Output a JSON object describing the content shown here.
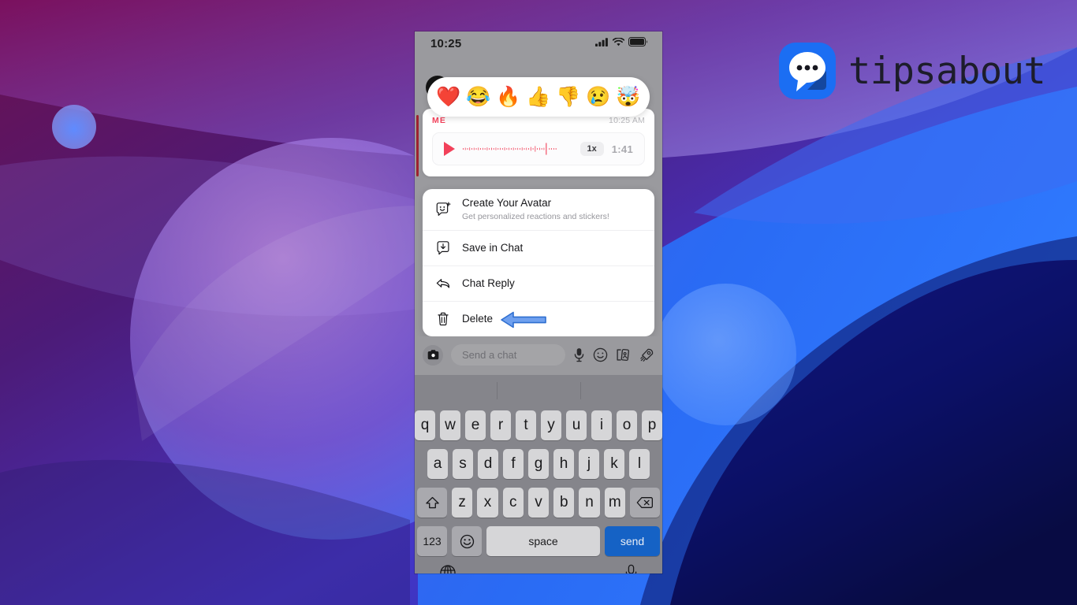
{
  "brand": {
    "name": "tipsabout",
    "logo_icon": "speech-bubble-dots-icon",
    "colors": {
      "mark_blue": "#1b6ef3",
      "mark_shadow": "#1546a0",
      "word": "#1d1d2b"
    }
  },
  "phone": {
    "status_bar": {
      "time": "10:25",
      "cellular_icon": "signal-bars-icon",
      "wifi_icon": "wifi-icon",
      "battery_icon": "battery-full-icon"
    },
    "reaction_bar": {
      "emojis": [
        {
          "name": "heart-emoji",
          "glyph": "❤️"
        },
        {
          "name": "joy-emoji",
          "glyph": "😂"
        },
        {
          "name": "fire-emoji",
          "glyph": "🔥"
        },
        {
          "name": "thumbs-up-emoji",
          "glyph": "👍"
        },
        {
          "name": "thumbs-down-emoji",
          "glyph": "👎"
        },
        {
          "name": "crying-emoji",
          "glyph": "😢"
        },
        {
          "name": "mind-blown-emoji",
          "glyph": "🤯"
        }
      ]
    },
    "message": {
      "sender": "ME",
      "timestamp": "10:25 AM",
      "play_icon": "play-icon",
      "waveform_icon": "audio-waveform",
      "speed": "1x",
      "duration": "1:41",
      "accent_color": "#f2415a"
    },
    "context_menu": {
      "items": [
        {
          "id": "create-your-avatar",
          "icon": "avatar-plus-icon",
          "title": "Create Your Avatar",
          "subtitle": "Get personalized reactions and stickers!"
        },
        {
          "id": "save-in-chat",
          "icon": "save-bubble-icon",
          "title": "Save in Chat",
          "subtitle": ""
        },
        {
          "id": "chat-reply",
          "icon": "reply-arrow-icon",
          "title": "Chat Reply",
          "subtitle": ""
        },
        {
          "id": "delete",
          "icon": "trash-icon",
          "title": "Delete",
          "subtitle": ""
        }
      ],
      "annotation": {
        "name": "blue-left-arrow-annotation",
        "points_at": "Delete",
        "color": "#4a86e8"
      }
    },
    "chat_input": {
      "camera_icon": "camera-icon",
      "placeholder": "Send a chat",
      "mic_icon": "microphone-icon",
      "sticker_icon": "smiley-sticker-icon",
      "cards_icon": "cards-icon",
      "rocket_icon": "rocket-icon"
    },
    "keyboard": {
      "row1": [
        "q",
        "w",
        "e",
        "r",
        "t",
        "y",
        "u",
        "i",
        "o",
        "p"
      ],
      "row2": [
        "a",
        "s",
        "d",
        "f",
        "g",
        "h",
        "j",
        "k",
        "l"
      ],
      "row3_letters": [
        "z",
        "x",
        "c",
        "v",
        "b",
        "n",
        "m"
      ],
      "shift_icon": "shift-icon",
      "backspace_icon": "backspace-icon",
      "numeric_label": "123",
      "emoji_icon": "emoji-keyboard-icon",
      "space_label": "space",
      "send_label": "send",
      "send_color": "#1562c5",
      "globe_icon": "globe-icon",
      "dictation_icon": "microphone-icon",
      "home_indicator": "home-indicator"
    }
  }
}
